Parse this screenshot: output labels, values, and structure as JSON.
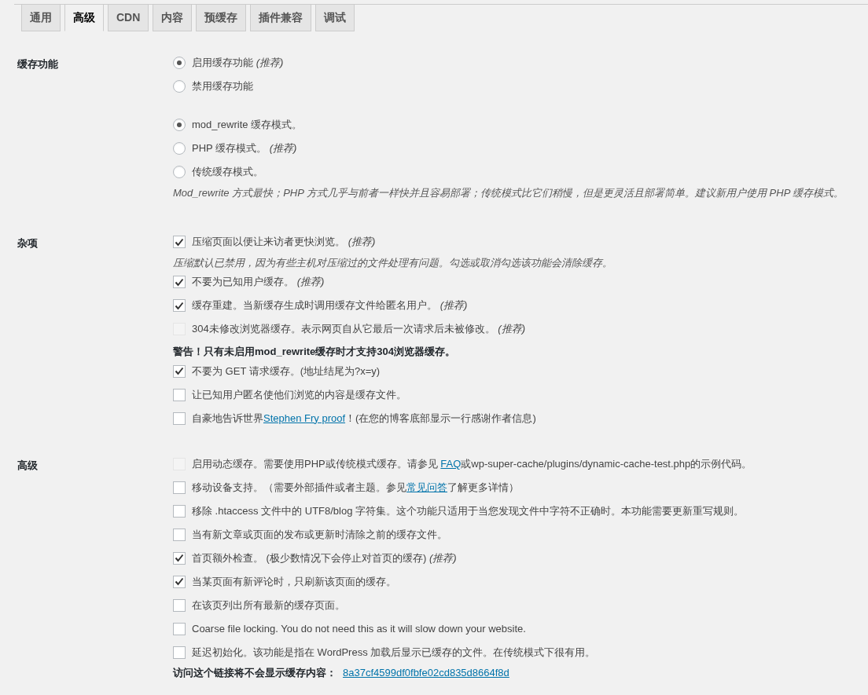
{
  "tabs": [
    {
      "label": "通用",
      "selected": false
    },
    {
      "label": "高级",
      "selected": true
    },
    {
      "label": "CDN",
      "selected": false
    },
    {
      "label": "内容",
      "selected": false
    },
    {
      "label": "预缓存",
      "selected": false
    },
    {
      "label": "插件兼容",
      "selected": false
    },
    {
      "label": "调试",
      "selected": false
    }
  ],
  "sections": [
    {
      "label": "缓存功能",
      "groups": [
        [
          {
            "kind": "radio",
            "selected": true,
            "text": "启用缓存功能 *(推荐)*"
          },
          {
            "kind": "radio",
            "selected": false,
            "text": "禁用缓存功能"
          }
        ],
        [
          {
            "kind": "radio",
            "selected": true,
            "text": "mod_rewrite 缓存模式。"
          },
          {
            "kind": "radio",
            "selected": false,
            "text": "PHP 缓存模式。 *(推荐)*"
          },
          {
            "kind": "radio",
            "selected": false,
            "text": "传统缓存模式。"
          },
          {
            "kind": "note",
            "text": "Mod_rewrite 方式最快；PHP 方式几乎与前者一样快并且容易部署；传统模式比它们稍慢，但是更灵活且部署简单。建议新用户使用 PHP 缓存模式。"
          }
        ]
      ]
    },
    {
      "label": "杂项",
      "groups": [
        [
          {
            "kind": "checkbox",
            "checked": true,
            "disabled": false,
            "text": "压缩页面以便让来访者更快浏览。 *(推荐)*"
          },
          {
            "kind": "note",
            "text": "压缩默认已禁用，因为有些主机对压缩过的文件处理有问题。勾选或取消勾选该功能会清除缓存。"
          },
          {
            "kind": "checkbox",
            "checked": true,
            "disabled": false,
            "text": "不要为已知用户缓存。 *(推荐)*"
          },
          {
            "kind": "checkbox",
            "checked": true,
            "disabled": false,
            "text": "缓存重建。当新缓存生成时调用缓存文件给匿名用户。 *(推荐)*"
          },
          {
            "kind": "checkbox",
            "checked": false,
            "disabled": true,
            "text": "304未修改浏览器缓存。表示网页自从它最后一次请求后未被修改。 *(推荐)*"
          },
          {
            "kind": "warning",
            "text": "警告！只有未启用mod_rewrite缓存时才支持304浏览器缓存。"
          },
          {
            "kind": "checkbox",
            "checked": true,
            "disabled": false,
            "text": "不要为 GET 请求缓存。(地址结尾为?x=y)"
          },
          {
            "kind": "checkbox",
            "checked": false,
            "disabled": false,
            "text": "让已知用户匿名使他们浏览的内容是缓存文件。"
          },
          {
            "kind": "checkbox",
            "checked": false,
            "disabled": false,
            "text": "自豪地告诉世界",
            "link": "Stephen Fry proof",
            "text_after": "！(在您的博客底部显示一行感谢作者信息)"
          }
        ]
      ]
    },
    {
      "label": "高级",
      "groups": [
        [
          {
            "kind": "checkbox",
            "checked": false,
            "disabled": true,
            "text": "启用动态缓存。需要使用PHP或传统模式缓存。请参见 ",
            "link": "FAQ",
            "text_after": "或wp-super-cache/plugins/dynamic-cache-test.php的示例代码。"
          },
          {
            "kind": "checkbox",
            "checked": false,
            "disabled": false,
            "text": "移动设备支持。（需要外部插件或者主题。参见",
            "link": "常见问答",
            "text_after": "了解更多详情）"
          },
          {
            "kind": "checkbox",
            "checked": false,
            "disabled": false,
            "text": "移除 .htaccess 文件中的 UTF8/blog 字符集。这个功能只适用于当您发现文件中字符不正确时。本功能需要更新重写规则。"
          },
          {
            "kind": "checkbox",
            "checked": false,
            "disabled": false,
            "text": "当有新文章或页面的发布或更新时清除之前的缓存文件。"
          },
          {
            "kind": "checkbox",
            "checked": true,
            "disabled": false,
            "text": "首页额外检查。 (极少数情况下会停止对首页的缓存) *(推荐)*"
          },
          {
            "kind": "checkbox",
            "checked": true,
            "disabled": false,
            "text": "当某页面有新评论时，只刷新该页面的缓存。"
          },
          {
            "kind": "checkbox",
            "checked": false,
            "disabled": false,
            "text": "在该页列出所有最新的缓存页面。"
          },
          {
            "kind": "checkbox",
            "checked": false,
            "disabled": false,
            "text": "Coarse file locking. You do not need this as it will slow down your website."
          },
          {
            "kind": "checkbox",
            "checked": false,
            "disabled": false,
            "text": "延迟初始化。该功能是指在 WordPress 加载后显示已缓存的文件。在传统模式下很有用。"
          },
          {
            "kind": "link_line",
            "text": "访问这个链接将不会显示缓存内容：",
            "link": "8a37cf4599df0fbfe02cd835d8664f8d"
          }
        ]
      ]
    }
  ]
}
